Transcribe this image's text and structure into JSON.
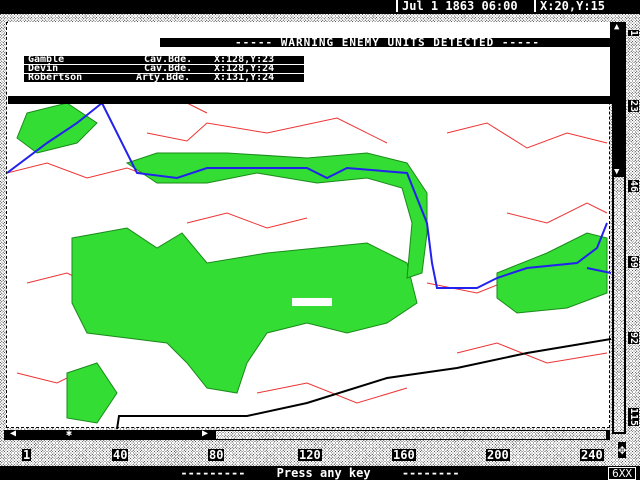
{
  "header": {
    "date": "Jul 1 1863 06:00",
    "cursor": "X:20,Y:15"
  },
  "dialog": {
    "title": "----- WARNING ENEMY UNITS DETECTED -----",
    "units": [
      {
        "name": "Gamble",
        "type": "Cav.Bde.",
        "location": "X:128,Y:23"
      },
      {
        "name": "Devin",
        "type": "Cav.Bde.",
        "location": "X:128,Y:24"
      },
      {
        "name": "Robertson",
        "type": "Arty.Bde.",
        "location": "X:131,Y:24"
      }
    ]
  },
  "x_axis": [
    "1",
    "40",
    "80",
    "120",
    "160",
    "200",
    "240"
  ],
  "y_axis": [
    "1",
    "23",
    "46",
    "69",
    "92",
    "115"
  ],
  "status": {
    "dash_left": "---------",
    "message": "Press any key",
    "dash_right": "--------",
    "mode": "6XX"
  },
  "colors": {
    "forest": "#33dd33",
    "river": "#2222ee",
    "contour": "#ee3333",
    "road": "#000000"
  }
}
